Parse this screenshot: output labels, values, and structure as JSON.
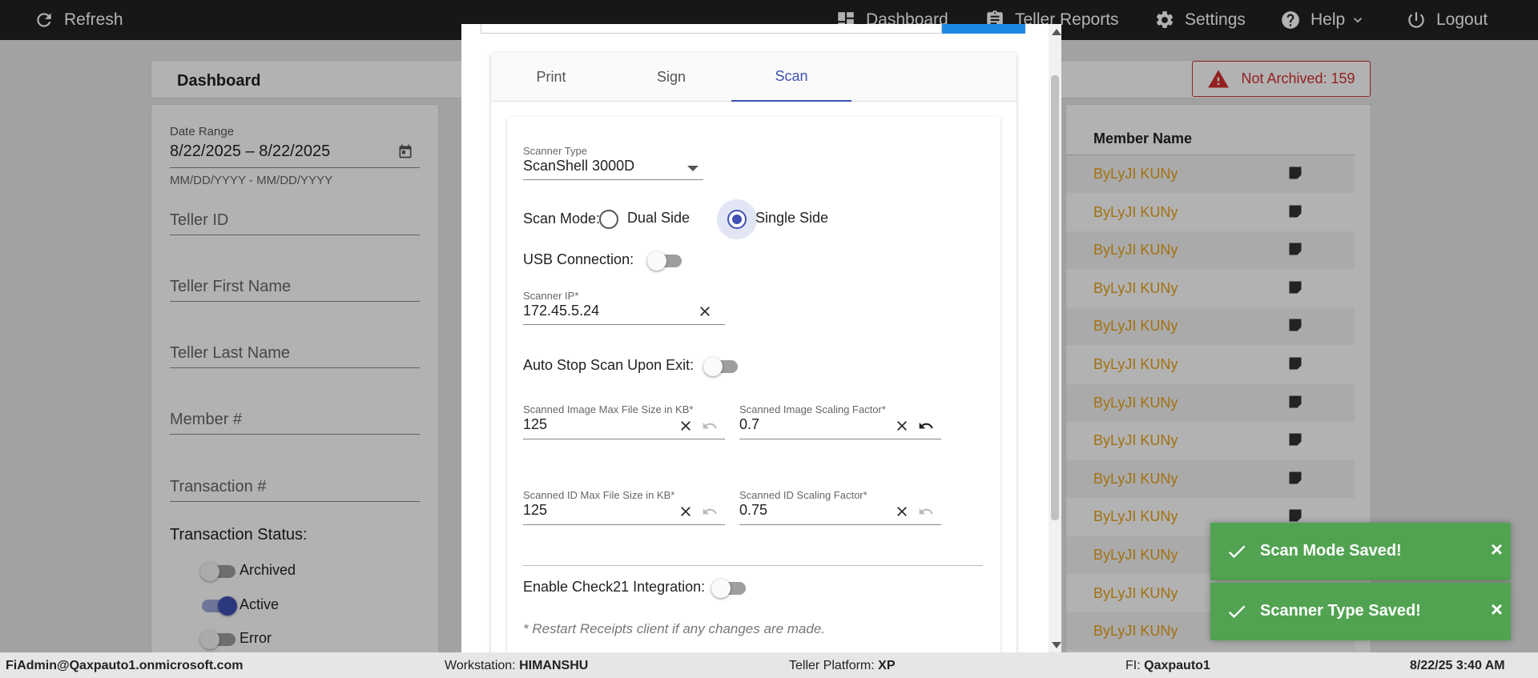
{
  "topbar": {
    "refresh": "Refresh",
    "dashboard": "Dashboard",
    "teller_reports": "Teller Reports",
    "settings": "Settings",
    "help": "Help",
    "logout": "Logout"
  },
  "dashboard": {
    "title": "Dashboard",
    "not_archived": "Not Archived: 159"
  },
  "filters": {
    "date_range_label": "Date Range",
    "date_range_value": "8/22/2025 – 8/22/2025",
    "date_hint": "MM/DD/YYYY - MM/DD/YYYY",
    "teller_id": "Teller ID",
    "teller_first_name": "Teller First Name",
    "teller_last_name": "Teller Last Name",
    "member_number": "Member #",
    "transaction_number": "Transaction #",
    "transaction_status": "Transaction Status:",
    "status_archived": "Archived",
    "status_active": "Active",
    "status_error": "Error"
  },
  "table": {
    "member_name_header": "Member Name",
    "rows": [
      "ByLyJI KUNy",
      "ByLyJI KUNy",
      "ByLyJI KUNy",
      "ByLyJI KUNy",
      "ByLyJI KUNy",
      "ByLyJI KUNy",
      "ByLyJI KUNy",
      "ByLyJI KUNy",
      "ByLyJI KUNy",
      "ByLyJI KUNy",
      "ByLyJI KUNy",
      "ByLyJI KUNy",
      "ByLyJI KUNy"
    ]
  },
  "modal": {
    "tabs": {
      "print": "Print",
      "sign": "Sign",
      "scan": "Scan"
    },
    "scanner_type_label": "Scanner Type",
    "scanner_type_value": "ScanShell 3000D",
    "scan_mode_label": "Scan Mode:",
    "dual_side": "Dual Side",
    "single_side": "Single Side",
    "usb_connection": "USB Connection:",
    "scanner_ip_label": "Scanner IP*",
    "scanner_ip_value": "172.45.5.24",
    "auto_stop": "Auto Stop Scan Upon Exit:",
    "img_max_label": "Scanned Image Max File Size in KB*",
    "img_max_value": "125",
    "img_scale_label": "Scanned Image Scaling Factor*",
    "img_scale_value": "0.7",
    "id_max_label": "Scanned ID Max File Size in KB*",
    "id_max_value": "125",
    "id_scale_label": "Scanned ID Scaling Factor*",
    "id_scale_value": "0.75",
    "check21": "Enable Check21 Integration:",
    "restart_hint": "* Restart Receipts client if any changes are made."
  },
  "statusbar": {
    "user": "FiAdmin@Qaxpauto1.onmicrosoft.com",
    "workstation_label": "Workstation:",
    "workstation_value": "HIMANSHU",
    "platform_label": "Teller Platform:",
    "platform_value": "XP",
    "fi_label": "FI:",
    "fi_value": "Qaxpauto1",
    "datetime": "8/22/25 3:40 AM"
  },
  "toasts": {
    "scan_mode_saved": "Scan Mode Saved!",
    "scanner_type_saved": "Scanner Type Saved!",
    "close": "×"
  },
  "colors": {
    "accent": "#3f51b5",
    "toast_success": "#51a351",
    "error": "#d32f2f",
    "member_name": "#e8a317"
  }
}
